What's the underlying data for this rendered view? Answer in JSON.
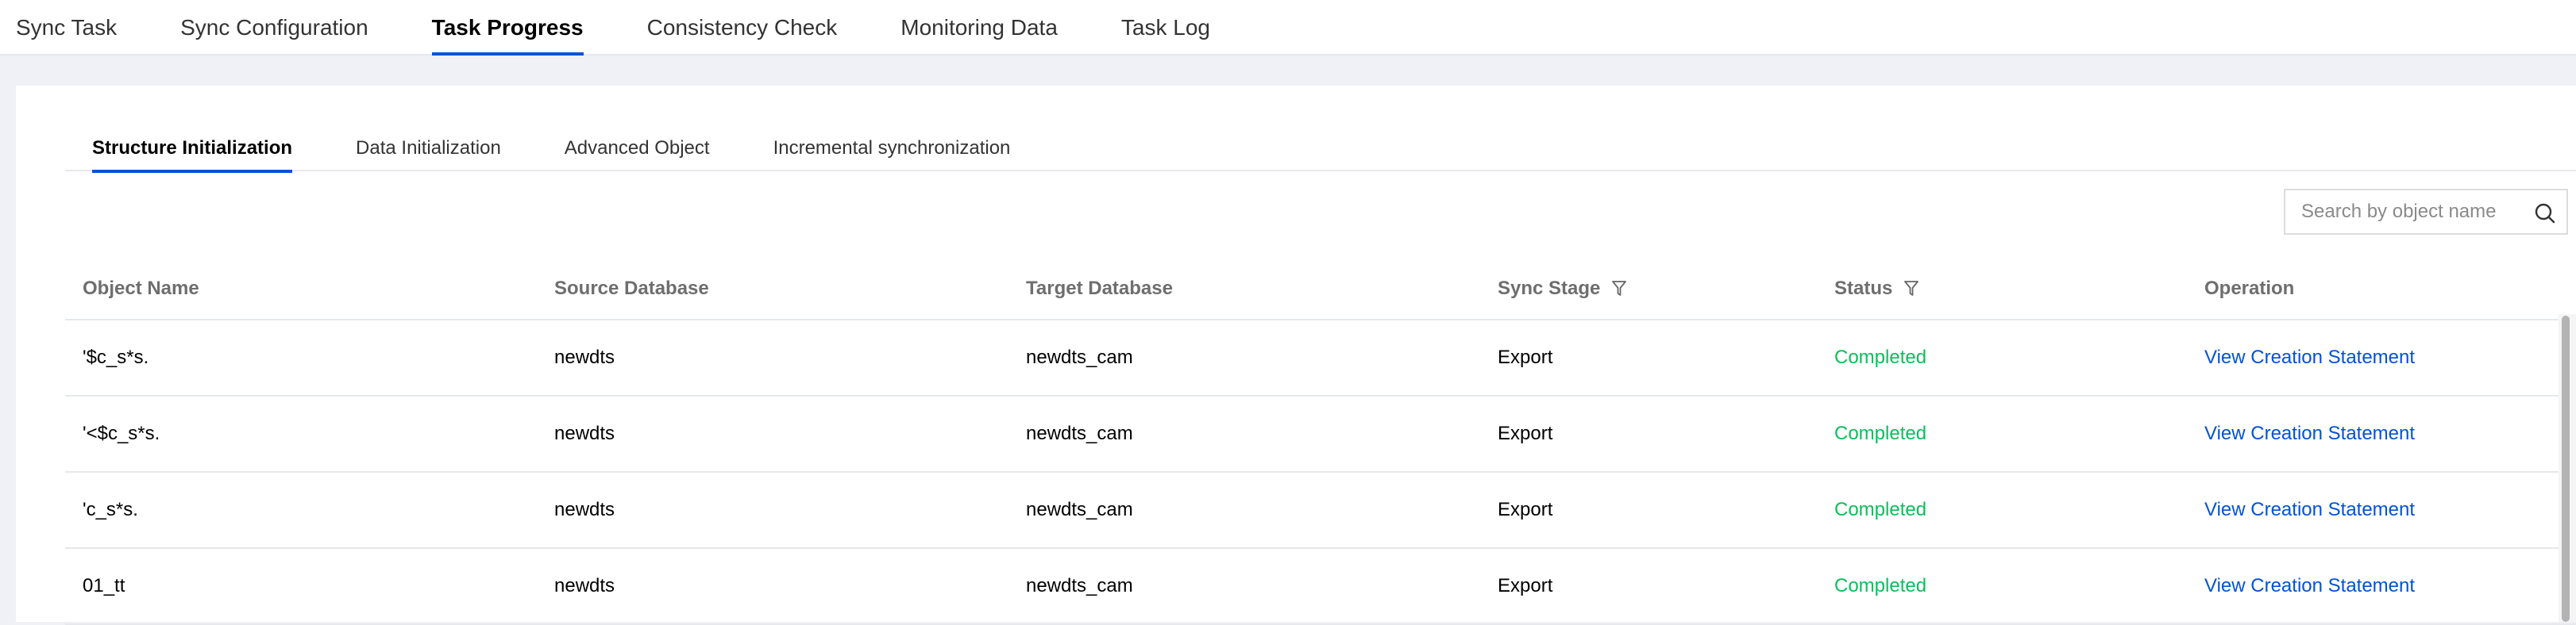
{
  "top_tabs": [
    {
      "label": "Sync Task",
      "active": false
    },
    {
      "label": "Sync Configuration",
      "active": false
    },
    {
      "label": "Task Progress",
      "active": true
    },
    {
      "label": "Consistency Check",
      "active": false
    },
    {
      "label": "Monitoring Data",
      "active": false
    },
    {
      "label": "Task Log",
      "active": false
    }
  ],
  "sub_tabs": [
    {
      "label": "Structure Initialization",
      "active": true
    },
    {
      "label": "Data Initialization",
      "active": false
    },
    {
      "label": "Advanced Object",
      "active": false
    },
    {
      "label": "Incremental synchronization",
      "active": false
    }
  ],
  "search": {
    "placeholder": "Search by object name",
    "icon": "search-icon"
  },
  "table": {
    "columns": [
      {
        "label": "Object Name",
        "filter": false
      },
      {
        "label": "Source Database",
        "filter": false
      },
      {
        "label": "Target Database",
        "filter": false
      },
      {
        "label": "Sync Stage",
        "filter": true
      },
      {
        "label": "Status",
        "filter": true
      },
      {
        "label": "Operation",
        "filter": false
      }
    ],
    "rows": [
      {
        "object_name": "'$c_s*s.",
        "source_db": "newdts",
        "target_db": "newdts_cam",
        "sync_stage": "Export",
        "status": "Completed",
        "operation": "View Creation Statement"
      },
      {
        "object_name": "'<$c_s*s.",
        "source_db": "newdts",
        "target_db": "newdts_cam",
        "sync_stage": "Export",
        "status": "Completed",
        "operation": "View Creation Statement"
      },
      {
        "object_name": "'c_s*s.",
        "source_db": "newdts",
        "target_db": "newdts_cam",
        "sync_stage": "Export",
        "status": "Completed",
        "operation": "View Creation Statement"
      },
      {
        "object_name": "01_tt",
        "source_db": "newdts",
        "target_db": "newdts_cam",
        "sync_stage": "Export",
        "status": "Completed",
        "operation": "View Creation Statement"
      }
    ]
  },
  "colors": {
    "accent": "#0052d9",
    "status_completed": "#0abf5b",
    "page_background": "#f0f1f6"
  }
}
